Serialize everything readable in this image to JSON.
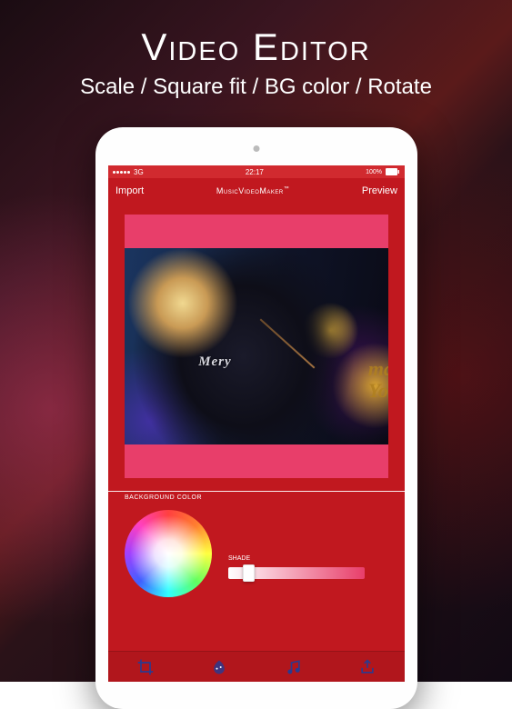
{
  "promo": {
    "title": "Video Editor",
    "subtitle": "Scale / Square fit / BG color / Rotate"
  },
  "statusbar": {
    "carrier": "3G",
    "time": "22:17",
    "battery": "100%"
  },
  "navbar": {
    "left": "Import",
    "title": "MusicVideoMaker",
    "title_suffix": "™",
    "right": "Preview"
  },
  "canvas": {
    "bg_hex": "#e83e6a",
    "shirt_text": "Mery",
    "backdrop_text_top": "ma",
    "backdrop_text_bottom": "Yot"
  },
  "controls": {
    "section_label": "BACKGROUND COLOR",
    "shade_label": "SHADE",
    "shade_value": 0.12
  },
  "tabs": {
    "crop": "crop",
    "bgcolor": "bgcolor",
    "music": "music",
    "share": "share"
  }
}
